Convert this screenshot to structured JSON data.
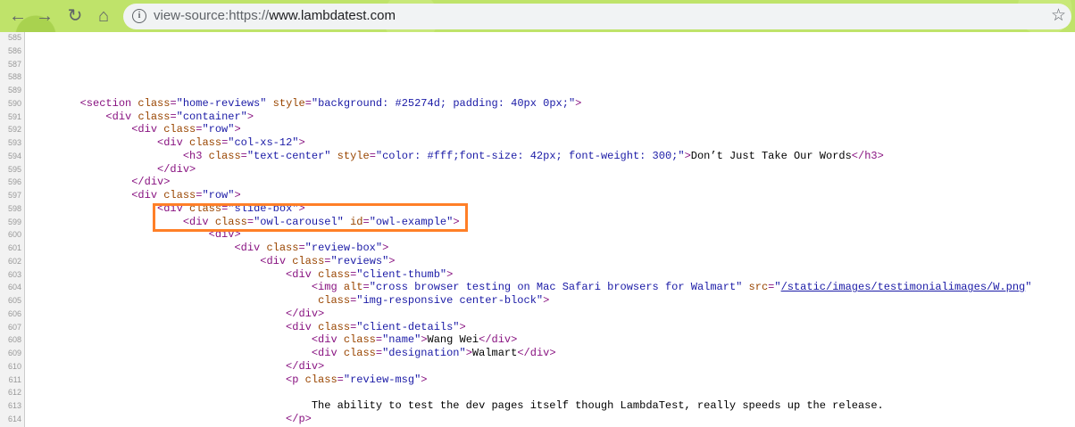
{
  "browser": {
    "url_prefix": "view-source:https://",
    "url_host": "www.lambdatest.com"
  },
  "lines": [
    {
      "n": "585",
      "t": []
    },
    {
      "n": "586",
      "t": []
    },
    {
      "n": "587",
      "t": []
    },
    {
      "n": "588",
      "t": []
    },
    {
      "n": "589",
      "t": []
    },
    {
      "n": "590",
      "t": [
        {
          "c": "txt",
          "v": "        "
        },
        {
          "c": "tag",
          "v": "<section "
        },
        {
          "c": "attr",
          "v": "class"
        },
        {
          "c": "tag",
          "v": "="
        },
        {
          "c": "val",
          "v": "\"home-reviews\""
        },
        {
          "c": "attr",
          "v": " style"
        },
        {
          "c": "tag",
          "v": "="
        },
        {
          "c": "val",
          "v": "\"background: #25274d; padding: 40px 0px;\""
        },
        {
          "c": "tag",
          "v": ">"
        }
      ]
    },
    {
      "n": "591",
      "t": [
        {
          "c": "txt",
          "v": "            "
        },
        {
          "c": "tag",
          "v": "<div "
        },
        {
          "c": "attr",
          "v": "class"
        },
        {
          "c": "tag",
          "v": "="
        },
        {
          "c": "val",
          "v": "\"container\""
        },
        {
          "c": "tag",
          "v": ">"
        }
      ]
    },
    {
      "n": "592",
      "t": [
        {
          "c": "txt",
          "v": "                "
        },
        {
          "c": "tag",
          "v": "<div "
        },
        {
          "c": "attr",
          "v": "class"
        },
        {
          "c": "tag",
          "v": "="
        },
        {
          "c": "val",
          "v": "\"row\""
        },
        {
          "c": "tag",
          "v": ">"
        }
      ]
    },
    {
      "n": "593",
      "t": [
        {
          "c": "txt",
          "v": "                    "
        },
        {
          "c": "tag",
          "v": "<div "
        },
        {
          "c": "attr",
          "v": "class"
        },
        {
          "c": "tag",
          "v": "="
        },
        {
          "c": "val",
          "v": "\"col-xs-12\""
        },
        {
          "c": "tag",
          "v": ">"
        }
      ]
    },
    {
      "n": "594",
      "t": [
        {
          "c": "txt",
          "v": "                        "
        },
        {
          "c": "tag",
          "v": "<h3 "
        },
        {
          "c": "attr",
          "v": "class"
        },
        {
          "c": "tag",
          "v": "="
        },
        {
          "c": "val",
          "v": "\"text-center\""
        },
        {
          "c": "attr",
          "v": " style"
        },
        {
          "c": "tag",
          "v": "="
        },
        {
          "c": "val",
          "v": "\"color: #fff;font-size: 42px; font-weight: 300;\""
        },
        {
          "c": "tag",
          "v": ">"
        },
        {
          "c": "txt",
          "v": "Don’t Just Take Our Words"
        },
        {
          "c": "tag",
          "v": "</h3>"
        }
      ]
    },
    {
      "n": "595",
      "t": [
        {
          "c": "txt",
          "v": "                    "
        },
        {
          "c": "tag",
          "v": "</div>"
        }
      ]
    },
    {
      "n": "596",
      "t": [
        {
          "c": "txt",
          "v": "                "
        },
        {
          "c": "tag",
          "v": "</div>"
        }
      ]
    },
    {
      "n": "597",
      "t": [
        {
          "c": "txt",
          "v": "                "
        },
        {
          "c": "tag",
          "v": "<div "
        },
        {
          "c": "attr",
          "v": "class"
        },
        {
          "c": "tag",
          "v": "="
        },
        {
          "c": "val",
          "v": "\"row\""
        },
        {
          "c": "tag",
          "v": ">"
        }
      ]
    },
    {
      "n": "598",
      "t": [
        {
          "c": "txt",
          "v": "                    "
        },
        {
          "c": "tag",
          "v": "<div "
        },
        {
          "c": "attr",
          "v": "class"
        },
        {
          "c": "tag",
          "v": "="
        },
        {
          "c": "val",
          "v": "\"slide-box\""
        },
        {
          "c": "tag",
          "v": ">"
        }
      ]
    },
    {
      "n": "599",
      "t": [
        {
          "c": "txt",
          "v": "                        "
        },
        {
          "c": "tag",
          "v": "<div "
        },
        {
          "c": "attr",
          "v": "class"
        },
        {
          "c": "tag",
          "v": "="
        },
        {
          "c": "val",
          "v": "\"owl-carousel\""
        },
        {
          "c": "attr",
          "v": " id"
        },
        {
          "c": "tag",
          "v": "="
        },
        {
          "c": "val",
          "v": "\"owl-example\""
        },
        {
          "c": "tag",
          "v": ">"
        }
      ]
    },
    {
      "n": "600",
      "t": [
        {
          "c": "txt",
          "v": "                            "
        },
        {
          "c": "tag",
          "v": "<div>"
        }
      ]
    },
    {
      "n": "601",
      "t": [
        {
          "c": "txt",
          "v": "                                "
        },
        {
          "c": "tag",
          "v": "<div "
        },
        {
          "c": "attr",
          "v": "class"
        },
        {
          "c": "tag",
          "v": "="
        },
        {
          "c": "val",
          "v": "\"review-box\""
        },
        {
          "c": "tag",
          "v": ">"
        }
      ]
    },
    {
      "n": "602",
      "t": [
        {
          "c": "txt",
          "v": "                                    "
        },
        {
          "c": "tag",
          "v": "<div "
        },
        {
          "c": "attr",
          "v": "class"
        },
        {
          "c": "tag",
          "v": "="
        },
        {
          "c": "val",
          "v": "\"reviews\""
        },
        {
          "c": "tag",
          "v": ">"
        }
      ]
    },
    {
      "n": "603",
      "t": [
        {
          "c": "txt",
          "v": "                                        "
        },
        {
          "c": "tag",
          "v": "<div "
        },
        {
          "c": "attr",
          "v": "class"
        },
        {
          "c": "tag",
          "v": "="
        },
        {
          "c": "val",
          "v": "\"client-thumb\""
        },
        {
          "c": "tag",
          "v": ">"
        }
      ]
    },
    {
      "n": "604",
      "t": [
        {
          "c": "txt",
          "v": "                                            "
        },
        {
          "c": "tag",
          "v": "<img "
        },
        {
          "c": "attr",
          "v": "alt"
        },
        {
          "c": "tag",
          "v": "="
        },
        {
          "c": "val",
          "v": "\"cross browser testing on Mac Safari browsers for Walmart\""
        },
        {
          "c": "attr",
          "v": " src"
        },
        {
          "c": "tag",
          "v": "="
        },
        {
          "c": "val",
          "v": "\""
        },
        {
          "c": "link",
          "v": "/static/images/testimonialimages/W.png"
        },
        {
          "c": "val",
          "v": "\""
        }
      ]
    },
    {
      "n": "605",
      "t": [
        {
          "c": "txt",
          "v": "                                             "
        },
        {
          "c": "attr",
          "v": "class"
        },
        {
          "c": "tag",
          "v": "="
        },
        {
          "c": "val",
          "v": "\"img-responsive center-block\""
        },
        {
          "c": "tag",
          "v": ">"
        }
      ]
    },
    {
      "n": "606",
      "t": [
        {
          "c": "txt",
          "v": "                                        "
        },
        {
          "c": "tag",
          "v": "</div>"
        }
      ]
    },
    {
      "n": "607",
      "t": [
        {
          "c": "txt",
          "v": "                                        "
        },
        {
          "c": "tag",
          "v": "<div "
        },
        {
          "c": "attr",
          "v": "class"
        },
        {
          "c": "tag",
          "v": "="
        },
        {
          "c": "val",
          "v": "\"client-details\""
        },
        {
          "c": "tag",
          "v": ">"
        }
      ]
    },
    {
      "n": "608",
      "t": [
        {
          "c": "txt",
          "v": "                                            "
        },
        {
          "c": "tag",
          "v": "<div "
        },
        {
          "c": "attr",
          "v": "class"
        },
        {
          "c": "tag",
          "v": "="
        },
        {
          "c": "val",
          "v": "\"name\""
        },
        {
          "c": "tag",
          "v": ">"
        },
        {
          "c": "txt",
          "v": "Wang Wei"
        },
        {
          "c": "tag",
          "v": "</div>"
        }
      ]
    },
    {
      "n": "609",
      "t": [
        {
          "c": "txt",
          "v": "                                            "
        },
        {
          "c": "tag",
          "v": "<div "
        },
        {
          "c": "attr",
          "v": "class"
        },
        {
          "c": "tag",
          "v": "="
        },
        {
          "c": "val",
          "v": "\"designation\""
        },
        {
          "c": "tag",
          "v": ">"
        },
        {
          "c": "txt",
          "v": "Walmart"
        },
        {
          "c": "tag",
          "v": "</div>"
        }
      ]
    },
    {
      "n": "610",
      "t": [
        {
          "c": "txt",
          "v": "                                        "
        },
        {
          "c": "tag",
          "v": "</div>"
        }
      ]
    },
    {
      "n": "611",
      "t": [
        {
          "c": "txt",
          "v": "                                        "
        },
        {
          "c": "tag",
          "v": "<p "
        },
        {
          "c": "attr",
          "v": "class"
        },
        {
          "c": "tag",
          "v": "="
        },
        {
          "c": "val",
          "v": "\"review-msg\""
        },
        {
          "c": "tag",
          "v": ">"
        }
      ]
    },
    {
      "n": "612",
      "t": []
    },
    {
      "n": "613",
      "t": [
        {
          "c": "txt",
          "v": "                                            The ability to test the dev pages itself though LambdaTest, really speeds up the release."
        }
      ]
    },
    {
      "n": "614",
      "t": [
        {
          "c": "txt",
          "v": "                                        "
        },
        {
          "c": "tag",
          "v": "</p>"
        }
      ]
    }
  ]
}
